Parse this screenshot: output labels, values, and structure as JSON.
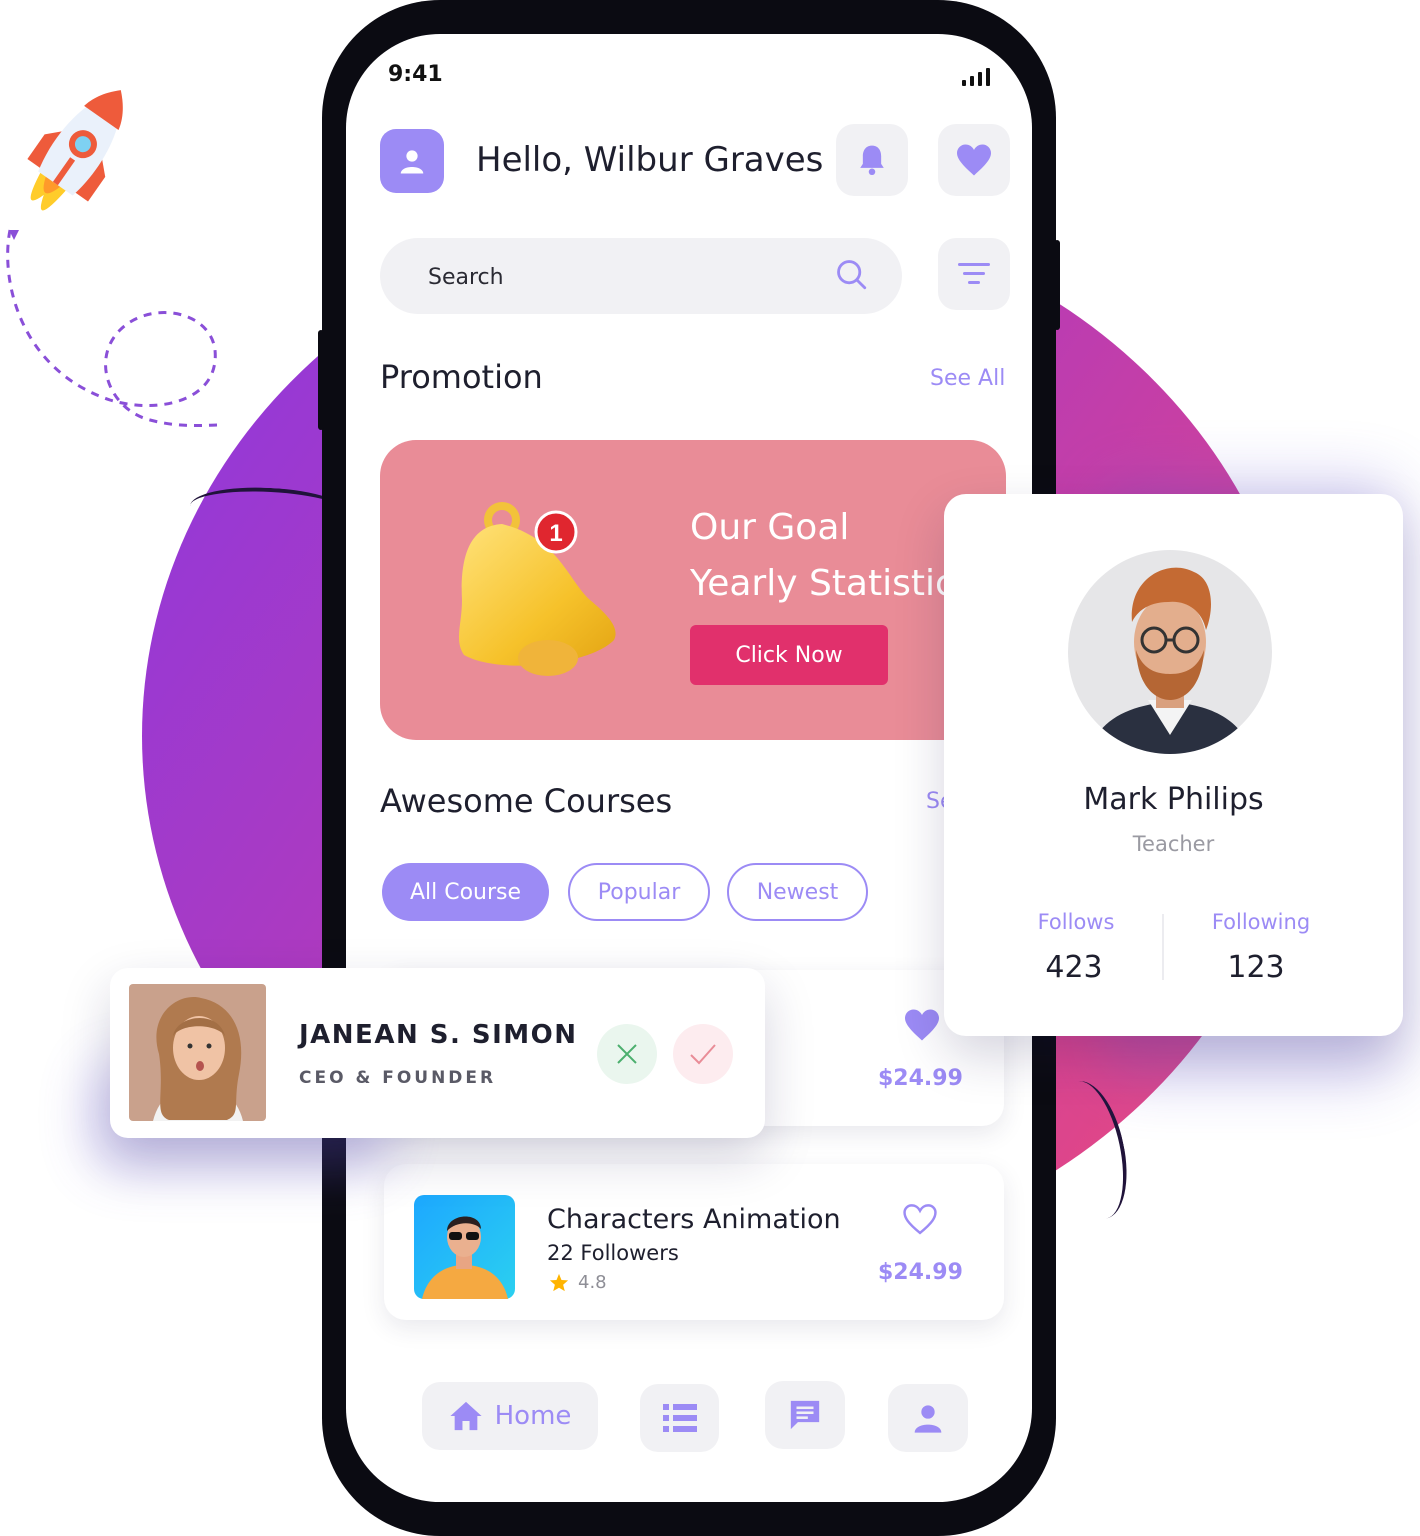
{
  "status_bar": {
    "time": "9:41"
  },
  "header": {
    "greeting": "Hello, Wilbur Graves"
  },
  "search": {
    "placeholder": "Search"
  },
  "promotion": {
    "title": "Promotion",
    "see_all": "See All",
    "banner_title": "Our Goal\nYearly Statistics",
    "badge_count": "1",
    "cta": "Click Now"
  },
  "courses": {
    "title": "Awesome Courses",
    "see_all_partial": "Se",
    "filters": [
      "All Course",
      "Popular",
      "Newest"
    ],
    "items": [
      {
        "price": "$24.99",
        "favorited": true
      },
      {
        "title": "Characters Animation",
        "followers": "22 Followers",
        "rating": "4.8",
        "price": "$24.99",
        "favorited": false
      }
    ]
  },
  "bottom_nav": {
    "home_label": "Home"
  },
  "profile_card": {
    "name": "Mark Philips",
    "role": "Teacher",
    "stats": [
      {
        "label": "Follows",
        "value": "423"
      },
      {
        "label": "Following",
        "value": "123"
      }
    ]
  },
  "person_card": {
    "name": "JANEAN S. SIMON",
    "title": "CEO & FOUNDER"
  },
  "colors": {
    "accent": "#9c8bf5",
    "promo_bg": "#e98c97",
    "promo_button": "#e1306c",
    "reject": "#4caf6e",
    "accept": "#e98c97"
  }
}
